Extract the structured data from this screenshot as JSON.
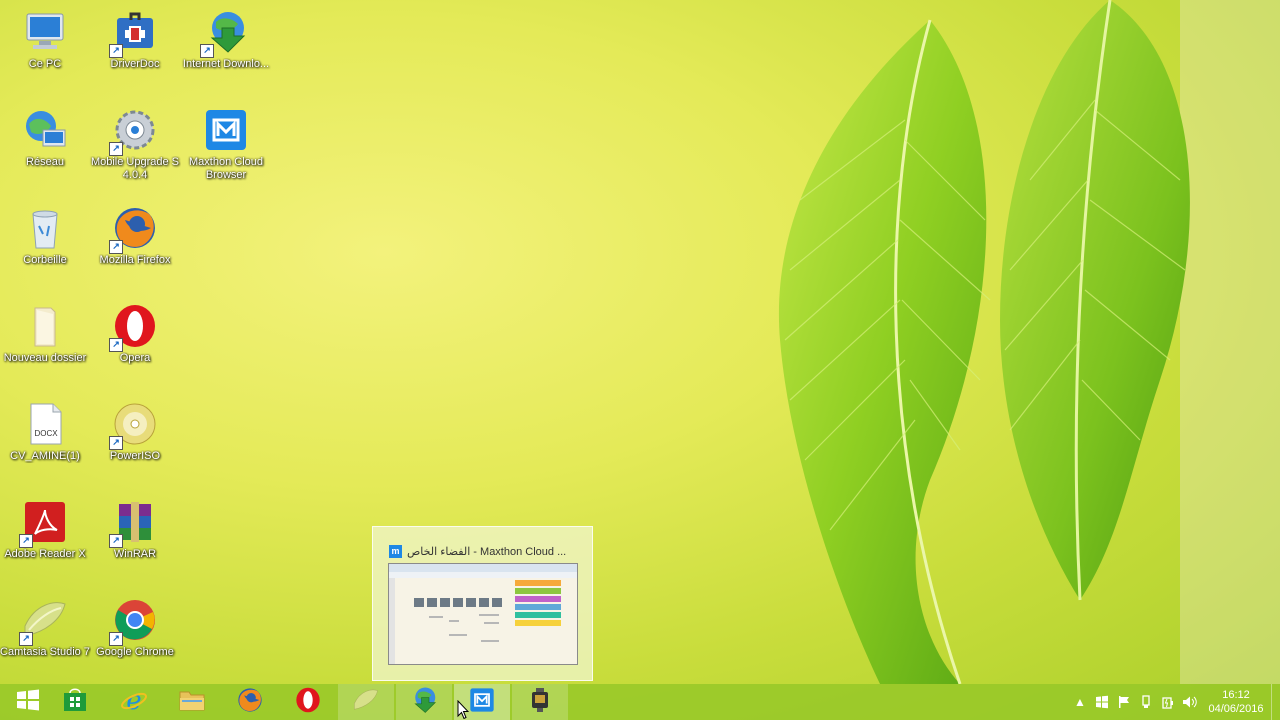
{
  "desktop": {
    "icons": [
      {
        "label": "Ce PC",
        "icon": "computer-icon"
      },
      {
        "label": "DriverDoc",
        "icon": "driverdoc-icon"
      },
      {
        "label": "Internet Downlo...",
        "icon": "internet-download-manager-icon"
      },
      {
        "label": "Réseau",
        "icon": "network-icon"
      },
      {
        "label": "Mobile Upgrade S 4.0.4",
        "icon": "mobile-upgrade-icon"
      },
      {
        "label": "Maxthon Cloud Browser",
        "icon": "maxthon-icon"
      },
      {
        "label": "Corbeille",
        "icon": "recycle-bin-icon"
      },
      {
        "label": "Mozilla Firefox",
        "icon": "firefox-icon"
      },
      {
        "label": "Nouveau dossier",
        "icon": "folder-icon"
      },
      {
        "label": "Opera",
        "icon": "opera-icon"
      },
      {
        "label": "CV_AMINE(1)",
        "icon": "docx-file-icon"
      },
      {
        "label": "PowerISO",
        "icon": "poweriso-icon"
      },
      {
        "label": "Adobe Reader X",
        "icon": "adobe-reader-icon"
      },
      {
        "label": "WinRAR",
        "icon": "winrar-icon"
      },
      {
        "label": "Camtasia Studio 7",
        "icon": "camtasia-icon"
      },
      {
        "label": "Google Chrome",
        "icon": "chrome-icon"
      }
    ],
    "docx_badge": "DOCX"
  },
  "preview": {
    "title": "الفضاء الخاص - Maxthon Cloud ...",
    "app_badge": "m"
  },
  "taskbar": {
    "items": [
      {
        "name": "start",
        "icon": "windows-logo-icon"
      },
      {
        "name": "store",
        "icon": "store-icon"
      },
      {
        "name": "internet-explorer",
        "icon": "internet-explorer-icon"
      },
      {
        "name": "file-explorer",
        "icon": "file-explorer-icon"
      },
      {
        "name": "firefox",
        "icon": "firefox-icon"
      },
      {
        "name": "opera",
        "icon": "opera-icon"
      },
      {
        "name": "camtasia",
        "icon": "camtasia-icon",
        "running": true
      },
      {
        "name": "internet-download-manager",
        "icon": "internet-download-manager-icon",
        "running": true
      },
      {
        "name": "maxthon",
        "icon": "maxthon-icon",
        "active": true
      },
      {
        "name": "camtasia-recorder",
        "icon": "camera-recorder-icon",
        "running": true
      }
    ]
  },
  "tray": {
    "icons": [
      "chevron-up-icon",
      "windows-defender-icon",
      "action-center-flag-icon",
      "usb-device-icon",
      "power-icon",
      "volume-icon"
    ],
    "time": "16:12",
    "date": "04/06/2016"
  },
  "colors": {
    "taskbar": "#96c828",
    "wallpaper": "#e4ea58",
    "leaf": "#7cc21e"
  }
}
